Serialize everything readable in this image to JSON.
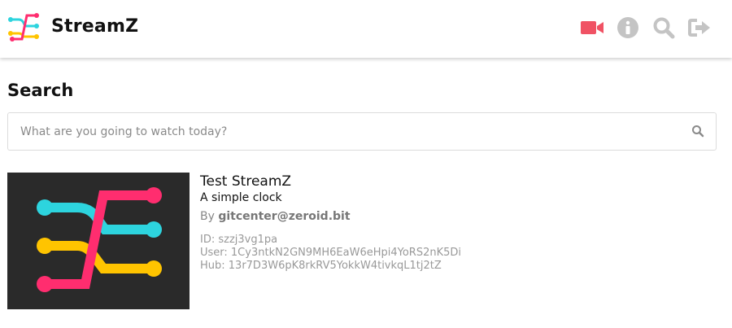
{
  "header": {
    "brand": "StreamZ",
    "icons": [
      "video-camera-icon",
      "info-icon",
      "search-icon",
      "sign-out-icon"
    ],
    "colors": {
      "accent": "#f05264",
      "icon_gray": "#c4c4c4"
    }
  },
  "page": {
    "title": "Search"
  },
  "search": {
    "placeholder": "What are you going to watch today?",
    "value": ""
  },
  "results": [
    {
      "title": "Test StreamZ",
      "description": "A simple clock",
      "by_label": "By",
      "author": "gitcenter@zeroid.bit",
      "id_line": "ID: szzj3vg1pa",
      "user_line": "User: 1Cy3ntkN2GN9MH6EaW6eHpi4YoRS2nK5Di",
      "hub_line": "Hub: 13r7D3W6pK8rkRV5YokkW4tivkqL1tj2tZ"
    }
  ],
  "logo_colors": {
    "pink": "#ff2d6f",
    "cyan": "#2dd4de",
    "yellow": "#ffc400",
    "thumb_bg": "#2a2a2a"
  }
}
